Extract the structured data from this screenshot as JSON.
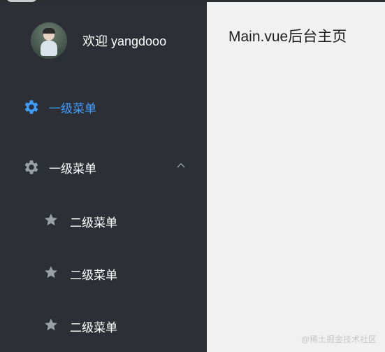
{
  "user": {
    "greeting": "欢迎 yangdooo",
    "avatar_icon": "avatar-image"
  },
  "menu": {
    "item1": {
      "label": "一级菜单",
      "icon": "gear-icon",
      "active": true,
      "color": "#409eff"
    },
    "item2": {
      "label": "一级菜单",
      "icon": "gear-icon",
      "expanded": true,
      "children": [
        {
          "label": "二级菜单",
          "icon": "star-icon"
        },
        {
          "label": "二级菜单",
          "icon": "star-icon"
        },
        {
          "label": "二级菜单",
          "icon": "star-icon"
        }
      ]
    }
  },
  "main": {
    "title": "Main.vue后台主页"
  },
  "watermark": "@稀土掘金技术社区",
  "colors": {
    "sidebar_bg": "#2c2f36",
    "active": "#409eff",
    "main_bg": "#f1f1f1"
  }
}
